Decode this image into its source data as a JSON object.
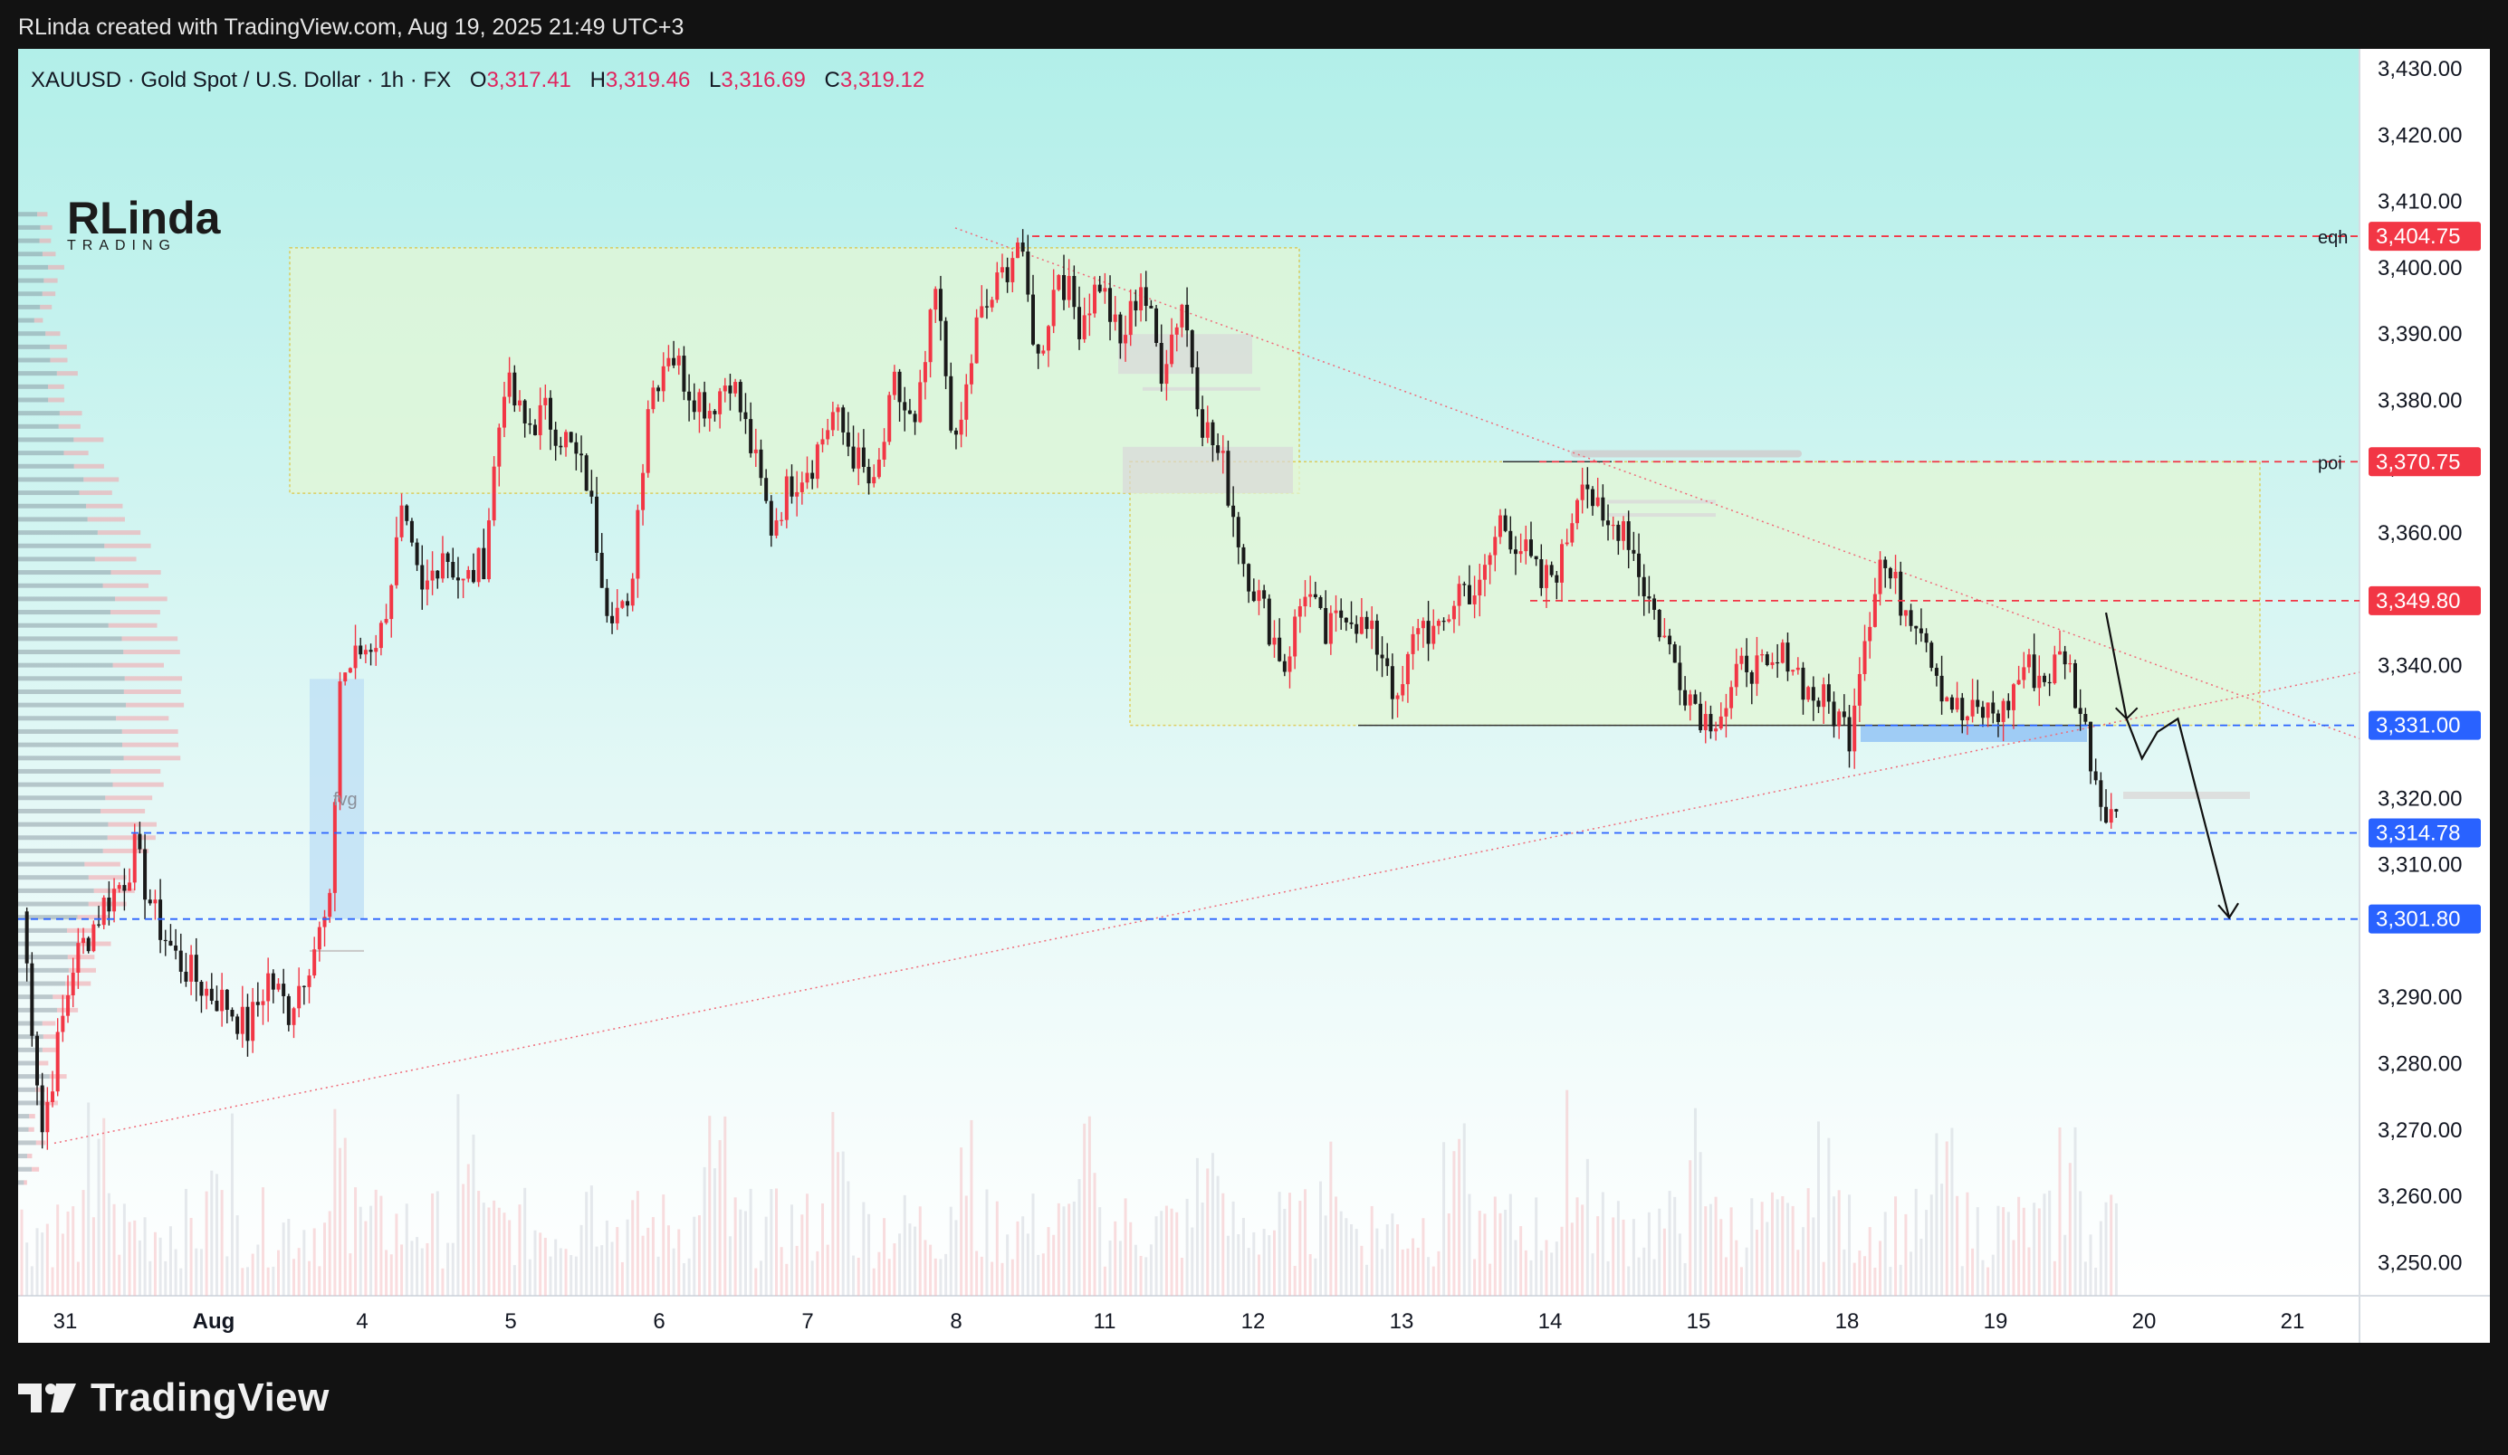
{
  "header": {
    "credit": "RLinda created with TradingView.com, Aug 19, 2025 21:49 UTC+3"
  },
  "symbol": {
    "label": "XAUUSD · Gold Spot / U.S. Dollar · 1h · FX",
    "open_label": "O",
    "open": "3,317.41",
    "high_label": "H",
    "high": "3,319.46",
    "low_label": "L",
    "low": "3,316.69",
    "close_label": "C",
    "close": "3,319.12"
  },
  "watermark": {
    "top": "RLinda",
    "bottom": "TRADING"
  },
  "footer": {
    "brand": "TradingView"
  },
  "colors": {
    "bull": "#f23645",
    "bear": "#1a1a1a",
    "bg_top": "#b2efe9",
    "bg_bottom": "#ffffff",
    "red_line": "#f23645",
    "blue_line": "#2962ff",
    "zone_fill": "#e3f7d6",
    "zone_border": "#e0c030"
  },
  "chart_data": {
    "type": "candlestick",
    "instrument": "XAUUSD",
    "timeframe": "1h",
    "y_axis": {
      "ticks": [
        "3,430.00",
        "3,420.00",
        "3,410.00",
        "3,400.00",
        "3,390.00",
        "3,380.00",
        "3,370.00",
        "3,360.00",
        "3,340.00",
        "3,320.00",
        "3,310.00",
        "3,290.00",
        "3,280.00",
        "3,270.00",
        "3,260.00",
        "3,250.00"
      ],
      "tick_values": [
        3430,
        3420,
        3410,
        3400,
        3390,
        3380,
        3370,
        3360,
        3340,
        3320,
        3310,
        3290,
        3280,
        3270,
        3260,
        3250
      ],
      "range": [
        3245,
        3433
      ]
    },
    "x_axis": {
      "labels": [
        "31",
        "Aug",
        "4",
        "5",
        "6",
        "7",
        "8",
        "11",
        "12",
        "13",
        "14",
        "15",
        "18",
        "19",
        "20",
        "21"
      ],
      "bold": [
        "Aug"
      ]
    },
    "price_levels": [
      {
        "name": "eqh",
        "label": "3,404.75",
        "value": 3404.75,
        "color": "#f23645",
        "note": "eqh"
      },
      {
        "name": "poi",
        "label": "3,370.75",
        "value": 3370.75,
        "color": "#f23645",
        "note": "poi"
      },
      {
        "name": "level-3349",
        "label": "3,349.80",
        "value": 3349.8,
        "color": "#f23645",
        "note": ""
      },
      {
        "name": "level-3331",
        "label": "3,331.00",
        "value": 3331.0,
        "color": "#2962ff",
        "note": ""
      },
      {
        "name": "level-3314",
        "label": "3,314.78",
        "value": 3314.78,
        "color": "#2962ff",
        "note": ""
      },
      {
        "name": "level-3301",
        "label": "3,301.80",
        "value": 3301.8,
        "color": "#2962ff",
        "note": ""
      }
    ],
    "annotations": [
      {
        "text": "fvg"
      }
    ],
    "anchors": [
      {
        "i": 0,
        "p": 3303
      },
      {
        "i": 4,
        "p": 3270
      },
      {
        "i": 10,
        "p": 3295
      },
      {
        "i": 16,
        "p": 3304
      },
      {
        "i": 20,
        "p": 3308
      },
      {
        "i": 22,
        "p": 3312
      },
      {
        "i": 26,
        "p": 3302
      },
      {
        "i": 30,
        "p": 3296
      },
      {
        "i": 36,
        "p": 3291
      },
      {
        "i": 40,
        "p": 3289
      },
      {
        "i": 44,
        "p": 3285
      },
      {
        "i": 48,
        "p": 3293
      },
      {
        "i": 52,
        "p": 3288
      },
      {
        "i": 56,
        "p": 3296
      },
      {
        "i": 60,
        "p": 3303
      },
      {
        "i": 62,
        "p": 3338
      },
      {
        "i": 66,
        "p": 3342
      },
      {
        "i": 70,
        "p": 3345
      },
      {
        "i": 74,
        "p": 3362
      },
      {
        "i": 78,
        "p": 3350
      },
      {
        "i": 82,
        "p": 3358
      },
      {
        "i": 86,
        "p": 3352
      },
      {
        "i": 90,
        "p": 3356
      },
      {
        "i": 94,
        "p": 3383
      },
      {
        "i": 98,
        "p": 3376
      },
      {
        "i": 102,
        "p": 3378
      },
      {
        "i": 106,
        "p": 3374
      },
      {
        "i": 110,
        "p": 3368
      },
      {
        "i": 114,
        "p": 3350
      },
      {
        "i": 118,
        "p": 3347
      },
      {
        "i": 122,
        "p": 3380
      },
      {
        "i": 126,
        "p": 3388
      },
      {
        "i": 130,
        "p": 3382
      },
      {
        "i": 134,
        "p": 3379
      },
      {
        "i": 138,
        "p": 3384
      },
      {
        "i": 142,
        "p": 3373
      },
      {
        "i": 146,
        "p": 3361
      },
      {
        "i": 150,
        "p": 3368
      },
      {
        "i": 154,
        "p": 3371
      },
      {
        "i": 158,
        "p": 3378
      },
      {
        "i": 162,
        "p": 3372
      },
      {
        "i": 166,
        "p": 3366
      },
      {
        "i": 170,
        "p": 3382
      },
      {
        "i": 174,
        "p": 3375
      },
      {
        "i": 178,
        "p": 3396
      },
      {
        "i": 182,
        "p": 3372
      },
      {
        "i": 186,
        "p": 3391
      },
      {
        "i": 190,
        "p": 3397
      },
      {
        "i": 194,
        "p": 3404
      },
      {
        "i": 198,
        "p": 3386
      },
      {
        "i": 202,
        "p": 3400
      },
      {
        "i": 206,
        "p": 3392
      },
      {
        "i": 210,
        "p": 3398
      },
      {
        "i": 214,
        "p": 3388
      },
      {
        "i": 218,
        "p": 3398
      },
      {
        "i": 222,
        "p": 3385
      },
      {
        "i": 226,
        "p": 3395
      },
      {
        "i": 230,
        "p": 3377
      },
      {
        "i": 234,
        "p": 3370
      },
      {
        "i": 238,
        "p": 3356
      },
      {
        "i": 242,
        "p": 3348
      },
      {
        "i": 246,
        "p": 3340
      },
      {
        "i": 250,
        "p": 3352
      },
      {
        "i": 254,
        "p": 3344
      },
      {
        "i": 258,
        "p": 3349
      },
      {
        "i": 262,
        "p": 3345
      },
      {
        "i": 266,
        "p": 3341
      },
      {
        "i": 268,
        "p": 3333
      },
      {
        "i": 272,
        "p": 3347
      },
      {
        "i": 276,
        "p": 3344
      },
      {
        "i": 280,
        "p": 3352
      },
      {
        "i": 284,
        "p": 3351
      },
      {
        "i": 288,
        "p": 3362
      },
      {
        "i": 292,
        "p": 3358
      },
      {
        "i": 296,
        "p": 3352
      },
      {
        "i": 300,
        "p": 3356
      },
      {
        "i": 304,
        "p": 3370
      },
      {
        "i": 308,
        "p": 3360
      },
      {
        "i": 312,
        "p": 3362
      },
      {
        "i": 316,
        "p": 3352
      },
      {
        "i": 320,
        "p": 3344
      },
      {
        "i": 324,
        "p": 3337
      },
      {
        "i": 328,
        "p": 3332
      },
      {
        "i": 332,
        "p": 3334
      },
      {
        "i": 336,
        "p": 3341
      },
      {
        "i": 340,
        "p": 3338
      },
      {
        "i": 344,
        "p": 3342
      },
      {
        "i": 348,
        "p": 3336
      },
      {
        "i": 352,
        "p": 3334
      },
      {
        "i": 356,
        "p": 3330
      },
      {
        "i": 358,
        "p": 3341
      },
      {
        "i": 362,
        "p": 3356
      },
      {
        "i": 366,
        "p": 3350
      },
      {
        "i": 370,
        "p": 3347
      },
      {
        "i": 374,
        "p": 3337
      },
      {
        "i": 378,
        "p": 3332
      },
      {
        "i": 382,
        "p": 3333
      },
      {
        "i": 386,
        "p": 3333
      },
      {
        "i": 390,
        "p": 3340
      },
      {
        "i": 394,
        "p": 3338
      },
      {
        "i": 398,
        "p": 3342
      },
      {
        "i": 402,
        "p": 3330
      },
      {
        "i": 405,
        "p": 3320
      },
      {
        "i": 408,
        "p": 3318
      }
    ],
    "forecast_path": [
      {
        "i": 406,
        "p": 3348
      },
      {
        "i": 410,
        "p": 3332
      },
      {
        "i": 413,
        "p": 3326
      },
      {
        "i": 416,
        "p": 3330
      },
      {
        "i": 420,
        "p": 3332
      },
      {
        "i": 430,
        "p": 3302
      }
    ]
  }
}
